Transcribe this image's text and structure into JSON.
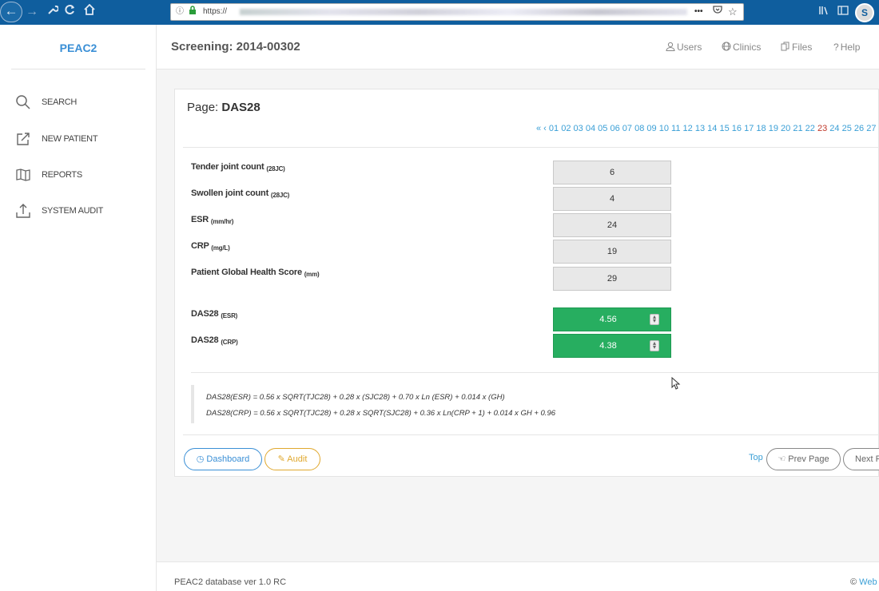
{
  "browser": {
    "back_icon": "←",
    "forward_icon": "→",
    "url_prefix": "https://",
    "info_icon": "ⓘ",
    "lock_icon": "🔒",
    "more_icon": "•••",
    "pocket_icon": "♡",
    "star_icon": "☆",
    "library_icon": "|||\\",
    "sidebar_icon": "◫",
    "avatar_letter": "S"
  },
  "sidebar": {
    "logo": "PEAC2",
    "items": [
      {
        "label": "SEARCH",
        "icon": "search-icon"
      },
      {
        "label": "NEW PATIENT",
        "icon": "external-link-icon"
      },
      {
        "label": "REPORTS",
        "icon": "map-icon"
      },
      {
        "label": "SYSTEM AUDIT",
        "icon": "upload-icon"
      }
    ]
  },
  "header": {
    "title": "Screening: 2014-00302",
    "nav": [
      {
        "label": "Users",
        "icon": "user-icon"
      },
      {
        "label": "Clinics",
        "icon": "globe-icon"
      },
      {
        "label": "Files",
        "icon": "files-icon"
      },
      {
        "label": "Help",
        "icon": "question-icon"
      }
    ]
  },
  "card": {
    "page_label": "Page:",
    "page_name": "DAS28",
    "pager_prefix": "« ‹",
    "pages_before": [
      "01",
      "02",
      "03",
      "04",
      "05",
      "06",
      "07",
      "08",
      "09",
      "10",
      "11",
      "12",
      "13",
      "14",
      "15",
      "16",
      "17",
      "18",
      "19",
      "20",
      "21",
      "22"
    ],
    "current_page": "23",
    "pages_after": [
      "24",
      "25",
      "26",
      "27"
    ],
    "fields": [
      {
        "label": "Tender joint count",
        "unit": "(28JC)",
        "value": "6"
      },
      {
        "label": "Swollen joint count",
        "unit": "(28JC)",
        "value": "4"
      },
      {
        "label": "ESR",
        "unit": "(mm/hr)",
        "value": "24"
      },
      {
        "label": "CRP",
        "unit": "(mg/L)",
        "value": "19"
      },
      {
        "label": "Patient Global Health Score",
        "unit": "(mm)",
        "value": "29"
      }
    ],
    "results": [
      {
        "label": "DAS28",
        "unit": "(ESR)",
        "value": "4.56"
      },
      {
        "label": "DAS28",
        "unit": "(CRP)",
        "value": "4.38"
      }
    ],
    "formula_esr": "DAS28(ESR) = 0.56 x SQRT(TJC28) + 0.28 x (SJC28) + 0.70 x Ln (ESR) + 0.014 x (GH)",
    "formula_crp": "DAS28(CRP) = 0.56 x SQRT(TJC28) + 0.28 x SQRT(SJC28) + 0.36 x Ln(CRP + 1) + 0.014 x GH + 0.96",
    "dashboard_label": "Dashboard",
    "audit_label": "Audit",
    "top_label": "Top",
    "prev_label": "Prev Page",
    "next_label": "Next P"
  },
  "footer": {
    "version": "PEAC2 database ver 1.0 RC",
    "copy_symbol": "©",
    "copy_link": "Web"
  },
  "colors": {
    "browser_bar": "#0f5e9e",
    "accent": "#3a8fd6",
    "result_green": "#27ae60",
    "audit_yellow": "#e0a82e",
    "current_page_red": "#c0392b"
  }
}
